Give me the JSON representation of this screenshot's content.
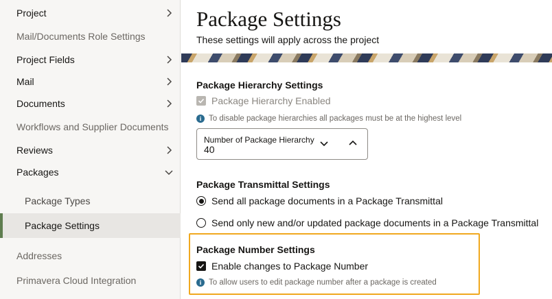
{
  "sidebar": {
    "items": [
      {
        "label": "Project",
        "chevron": "right"
      },
      {
        "label": "Mail/Documents Role Settings",
        "chevron": ""
      },
      {
        "label": "Project Fields",
        "chevron": "right"
      },
      {
        "label": "Mail",
        "chevron": "right"
      },
      {
        "label": "Documents",
        "chevron": "right"
      },
      {
        "label": "Workflows and Supplier Documents",
        "chevron": ""
      },
      {
        "label": "Reviews",
        "chevron": "right"
      },
      {
        "label": "Packages",
        "chevron": "down"
      },
      {
        "label": "Package Types",
        "chevron": ""
      },
      {
        "label": "Package Settings",
        "chevron": "",
        "active": true
      },
      {
        "label": "Addresses",
        "chevron": ""
      },
      {
        "label": "Primavera Cloud Integration",
        "chevron": ""
      }
    ]
  },
  "main": {
    "title": "Package Settings",
    "subtitle": "These settings will apply across the project",
    "hierarchy": {
      "title": "Package Hierarchy Settings",
      "checkbox_label": "Package Hierarchy Enabled",
      "checked": true,
      "disabled": true,
      "info": "To disable package hierarchies all packages must be at the highest level",
      "select_label": "Number of Package Hierarchy",
      "select_value": "40"
    },
    "transmittal": {
      "title": "Package Transmittal Settings",
      "options": [
        {
          "label": "Send all package documents in a Package Transmittal",
          "selected": true
        },
        {
          "label": "Send only new and/or updated package documents in a Package Transmittal",
          "selected": false
        }
      ]
    },
    "number": {
      "title": "Package Number Settings",
      "checkbox_label": "Enable changes to Package Number",
      "checked": true,
      "info": "To allow users to edit package number after a package is created"
    }
  },
  "colors": {
    "highlight": "#f0a81e",
    "active_bar": "#5f7d4f",
    "info": "#2a6b8f"
  }
}
